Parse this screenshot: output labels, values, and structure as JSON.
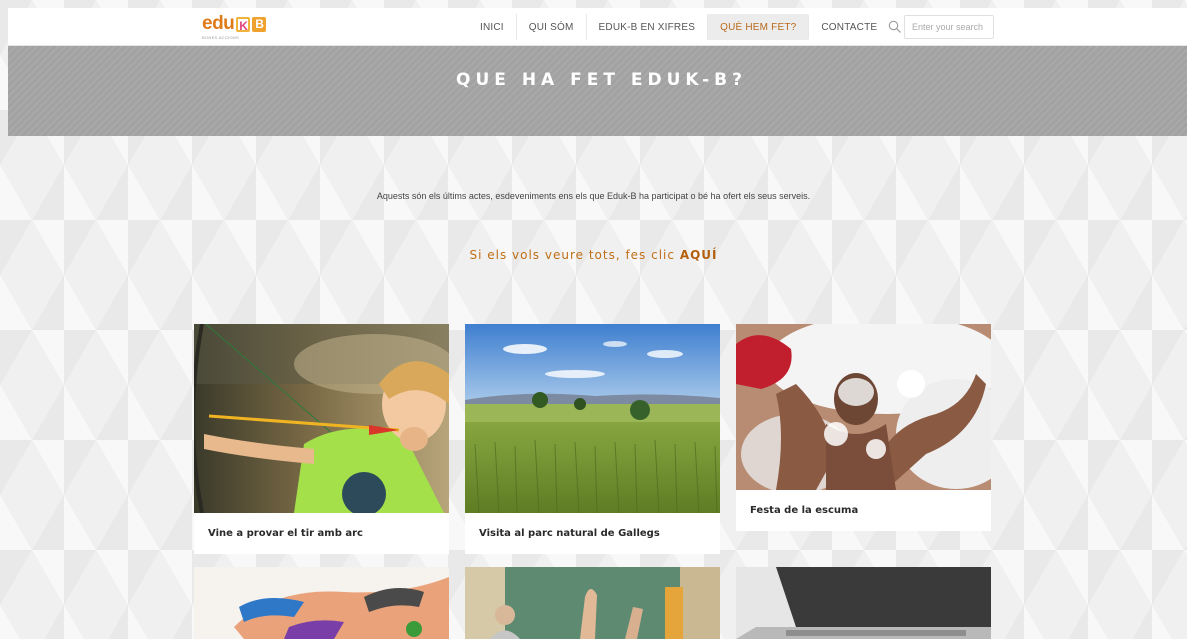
{
  "header": {
    "logo": {
      "text": "edu",
      "k": "K",
      "b": "B",
      "tagline": "BONES ACCIONS"
    },
    "nav": [
      {
        "label": "INICI",
        "active": false
      },
      {
        "label": "QUI SÓM",
        "active": false
      },
      {
        "label": "EDUK-B EN XIFRES",
        "active": false
      },
      {
        "label": "QUÈ HEM FET?",
        "active": true
      },
      {
        "label": "CONTACTE",
        "active": false
      }
    ],
    "search": {
      "placeholder": "Enter your search",
      "icon": "search-icon"
    }
  },
  "banner": {
    "title": "QUE HA FET EDUK-B?"
  },
  "intro": {
    "text": "Aquests són els últims actes, esdeveniments ens els que Eduk-B ha participat o bé ha ofert els seus serveis."
  },
  "cta": {
    "prefix": "Si els vols veure tots, fes clic ",
    "link": "AQUÍ"
  },
  "cards": [
    {
      "title": "Vine a provar el tir amb arc",
      "image": "archery-photo"
    },
    {
      "title": "Visita al parc natural de Gallegs",
      "image": "wheat-field-photo"
    },
    {
      "title": "Festa de la escuma",
      "image": "foam-party-photo"
    },
    {
      "title": "",
      "image": "painted-hands-photo"
    },
    {
      "title": "",
      "image": "classroom-photo"
    },
    {
      "title": "",
      "image": "laptop-photo"
    }
  ],
  "colors": {
    "accent": "#c06e16",
    "banner": "#a2a2a2",
    "nav_active_bg": "#ececec"
  }
}
